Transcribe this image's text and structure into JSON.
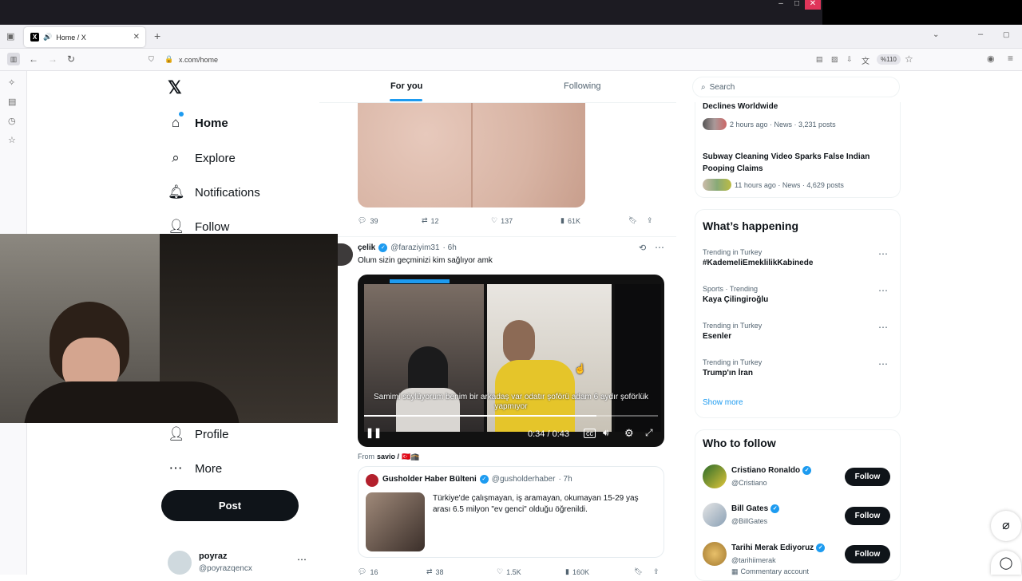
{
  "browser": {
    "tab_title": "Home / X",
    "url": "x.com/home",
    "zoom": "%110"
  },
  "nav": {
    "items": [
      {
        "label": "Home",
        "icon": "home-icon"
      },
      {
        "label": "Explore",
        "icon": "search-icon"
      },
      {
        "label": "Notifications",
        "icon": "bell-icon"
      },
      {
        "label": "Follow",
        "icon": "add-user-icon"
      },
      {
        "label": "Profile",
        "icon": "user-icon"
      },
      {
        "label": "More",
        "icon": "more-circle-icon"
      }
    ],
    "post_label": "Post",
    "account": {
      "name": "poyraz",
      "handle": "@poyrazqencx"
    }
  },
  "feed": {
    "tabs": [
      "For you",
      "Following"
    ],
    "first_post_stats": {
      "replies": "39",
      "reposts": "12",
      "likes": "137",
      "views": "61K"
    },
    "post": {
      "author": "çelik",
      "handle": "@faraziyim31",
      "time": "· 6h",
      "text": "Olum sizin geçminizi kim sağlıyor amk",
      "video_caption": "Samimi söylüyorum benim bir arkadaş var odatır şoförü adam 6 aydır şoförlük yapmıyor",
      "video_time": "0:34 / 0:43",
      "video_progress": 0.79,
      "from_prefix": "From",
      "from_user": "savio /",
      "from_flags": "🇹🇷🕋",
      "quote": {
        "author": "Gusholder Haber Bülteni",
        "handle": "@gusholderhaber",
        "time": "· 7h",
        "text": "Türkiye'de çalışmayan, iş aramayan, okumayan 15-29 yaş arası 6.5 milyon \"ev genci\" olduğu öğrenildi."
      },
      "stats": {
        "replies": "16",
        "reposts": "38",
        "likes": "1.5K",
        "views": "160K"
      }
    }
  },
  "right": {
    "search_placeholder": "Search",
    "news": [
      {
        "title": "Declines Worldwide",
        "meta": "2 hours ago · News · 3,231 posts"
      },
      {
        "title": "Subway Cleaning Video Sparks False Indian Pooping Claims",
        "meta": "11 hours ago · News · 4,629 posts"
      }
    ],
    "happening_title": "What’s happening",
    "trends": [
      {
        "context": "Trending in Turkey",
        "name": "#KademeliEmeklilikKabinede"
      },
      {
        "context": "Sports · Trending",
        "name": "Kaya Çilingiroğlu"
      },
      {
        "context": "Trending in Turkey",
        "name": "Esenler"
      },
      {
        "context": "Trending in Turkey",
        "name": "Trump'ın İran"
      }
    ],
    "show_more": "Show more",
    "who_title": "Who to follow",
    "follow_label": "Follow",
    "suggestions": [
      {
        "name": "Cristiano Ronaldo",
        "handle": "@Cristiano"
      },
      {
        "name": "Bill Gates",
        "handle": "@BillGates"
      },
      {
        "name": "Tarihi Merak Ediyoruz",
        "handle": "@tarihiimerak",
        "extra": "Commentary account"
      }
    ]
  },
  "colors": {
    "accent": "#1d9bf0",
    "text": "#0f1419",
    "secondary": "#536471",
    "post_button": "#0f1419"
  }
}
